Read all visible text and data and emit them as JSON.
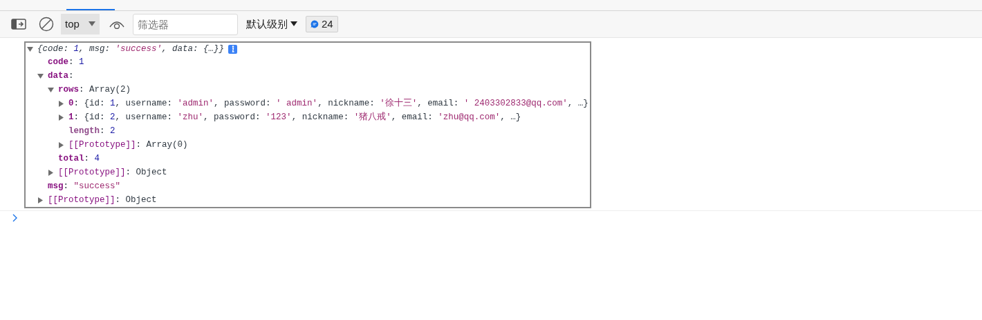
{
  "toolbar": {
    "context": "top",
    "filter": {
      "placeholder": "筛选器"
    },
    "level_dropdown": "默认级别",
    "message_count": "24"
  },
  "console": {
    "entries": [
      {
        "expanded": true,
        "summary": [
          {
            "kind": "punct",
            "text": "{"
          },
          {
            "kind": "plain",
            "text": "code: "
          },
          {
            "kind": "number",
            "text": "1"
          },
          {
            "kind": "plain",
            "text": ", msg: "
          },
          {
            "kind": "string",
            "text": "'success'"
          },
          {
            "kind": "plain",
            "text": ", data: {…}}"
          }
        ],
        "children": [
          {
            "line": [
              {
                "kind": "key",
                "text": "code"
              },
              {
                "kind": "punct",
                "text": ": "
              },
              {
                "kind": "number",
                "text": "1"
              }
            ]
          },
          {
            "expanded": true,
            "line": [
              {
                "kind": "key",
                "text": "data"
              },
              {
                "kind": "punct",
                "text": ":"
              }
            ],
            "children": [
              {
                "expanded": true,
                "line": [
                  {
                    "kind": "key",
                    "text": "rows"
                  },
                  {
                    "kind": "punct",
                    "text": ": "
                  },
                  {
                    "kind": "plain",
                    "text": "Array(2)"
                  }
                ],
                "children": [
                  {
                    "expanded": false,
                    "line": [
                      {
                        "kind": "key",
                        "text": "0"
                      },
                      {
                        "kind": "punct",
                        "text": ": "
                      },
                      {
                        "kind": "plain",
                        "text": "{id: "
                      },
                      {
                        "kind": "number",
                        "text": "1"
                      },
                      {
                        "kind": "plain",
                        "text": ", username: "
                      },
                      {
                        "kind": "string",
                        "text": "'admin'"
                      },
                      {
                        "kind": "plain",
                        "text": ", password: "
                      },
                      {
                        "kind": "string",
                        "text": "' admin'"
                      },
                      {
                        "kind": "plain",
                        "text": ", nickname: "
                      },
                      {
                        "kind": "string",
                        "text": "'徐十三'"
                      },
                      {
                        "kind": "plain",
                        "text": ", email: "
                      },
                      {
                        "kind": "string",
                        "text": "' 2403302833@qq.com'"
                      },
                      {
                        "kind": "plain",
                        "text": ", …}"
                      }
                    ]
                  },
                  {
                    "expanded": false,
                    "line": [
                      {
                        "kind": "key",
                        "text": "1"
                      },
                      {
                        "kind": "punct",
                        "text": ": "
                      },
                      {
                        "kind": "plain",
                        "text": "{id: "
                      },
                      {
                        "kind": "number",
                        "text": "2"
                      },
                      {
                        "kind": "plain",
                        "text": ", username: "
                      },
                      {
                        "kind": "string",
                        "text": "'zhu'"
                      },
                      {
                        "kind": "plain",
                        "text": ", password: "
                      },
                      {
                        "kind": "string",
                        "text": "'123'"
                      },
                      {
                        "kind": "plain",
                        "text": ", nickname: "
                      },
                      {
                        "kind": "string",
                        "text": "'猪八戒'"
                      },
                      {
                        "kind": "plain",
                        "text": ", email: "
                      },
                      {
                        "kind": "string",
                        "text": "'zhu@qq.com'"
                      },
                      {
                        "kind": "plain",
                        "text": ", …}"
                      }
                    ]
                  },
                  {
                    "line": [
                      {
                        "kind": "hidden_key",
                        "text": "length"
                      },
                      {
                        "kind": "punct",
                        "text": ": "
                      },
                      {
                        "kind": "number",
                        "text": "2"
                      }
                    ]
                  },
                  {
                    "expanded": false,
                    "line": [
                      {
                        "kind": "internal_key",
                        "text": "[[Prototype]]"
                      },
                      {
                        "kind": "punct",
                        "text": ": "
                      },
                      {
                        "kind": "plain",
                        "text": "Array(0)"
                      }
                    ]
                  }
                ]
              },
              {
                "line": [
                  {
                    "kind": "key",
                    "text": "total"
                  },
                  {
                    "kind": "punct",
                    "text": ": "
                  },
                  {
                    "kind": "number",
                    "text": "4"
                  }
                ]
              },
              {
                "expanded": false,
                "line": [
                  {
                    "kind": "internal_key",
                    "text": "[[Prototype]]"
                  },
                  {
                    "kind": "punct",
                    "text": ": "
                  },
                  {
                    "kind": "plain",
                    "text": "Object"
                  }
                ]
              }
            ]
          },
          {
            "line": [
              {
                "kind": "key",
                "text": "msg"
              },
              {
                "kind": "punct",
                "text": ": "
              },
              {
                "kind": "string",
                "text": "\"success\""
              }
            ]
          },
          {
            "expanded": false,
            "line": [
              {
                "kind": "internal_key",
                "text": "[[Prototype]]"
              },
              {
                "kind": "punct",
                "text": ": "
              },
              {
                "kind": "plain",
                "text": "Object"
              }
            ]
          }
        ]
      }
    ]
  }
}
